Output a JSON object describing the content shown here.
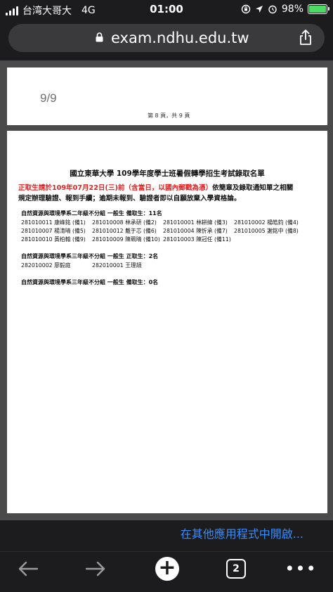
{
  "status": {
    "carrier": "台湾大哥大",
    "network": "4G",
    "time": "01:00",
    "battery": "98%",
    "battery_level": 0.98
  },
  "address_bar": {
    "url": "exam.ndhu.edu.tw"
  },
  "document": {
    "page_counter": "9/9",
    "page_footer": "第 8 頁，共 9 頁",
    "title": "國立東華大學 109學年度學士班暑假轉學招生考試錄取名單",
    "notice_red": "正取生請於109年07月22日(三)前（含當日，以國內郵戳為憑）",
    "notice_rest_1": "依簡章及錄取通知單之相關",
    "notice_line2": "規定辦理驗證、報到手續；逾期未報到、驗證者即以自願放棄入學資格論。",
    "sections": [
      {
        "heading": "自然資源與環境學系二年級不分組 一般生 備取生：11名",
        "rows": [
          [
            "281010011  康峰銘 (備1)",
            "281010008  林承研 (備2)",
            "281010001  林耕緯 (備3)",
            "281010002  楊皓鈞 (備4)"
          ],
          [
            "281010007  楊淯晴 (備5)",
            "281010012  戴于芯 (備6)",
            "281010004  陳忻承 (備7)",
            "281010005  謝銘中 (備8)"
          ],
          [
            "281010010  黃柏翰 (備9)",
            "281010009  陳珮晴 (備10)",
            "281010003  陳冠任 (備11)"
          ]
        ]
      },
      {
        "heading": "自然資源與環境學系三年級不分組 一般生 正取生：2名",
        "rows": [
          [
            "282010002  廖毅庭",
            "282010001  王理頡"
          ]
        ]
      },
      {
        "heading": "自然資源與環境學系三年級不分組 一般生 備取生：0名",
        "rows": []
      }
    ]
  },
  "open_in_other_app": "在其他應用程式中開啟...",
  "toolbar": {
    "back_icon": "back-arrow-icon",
    "forward_icon": "forward-arrow-icon",
    "new_tab_icon": "plus-icon",
    "tab_count": "2",
    "more_icon": "more-dots-icon"
  },
  "colors": {
    "link": "#3a8df7",
    "notice_red": "#e02020",
    "battery": "#4cd964"
  }
}
